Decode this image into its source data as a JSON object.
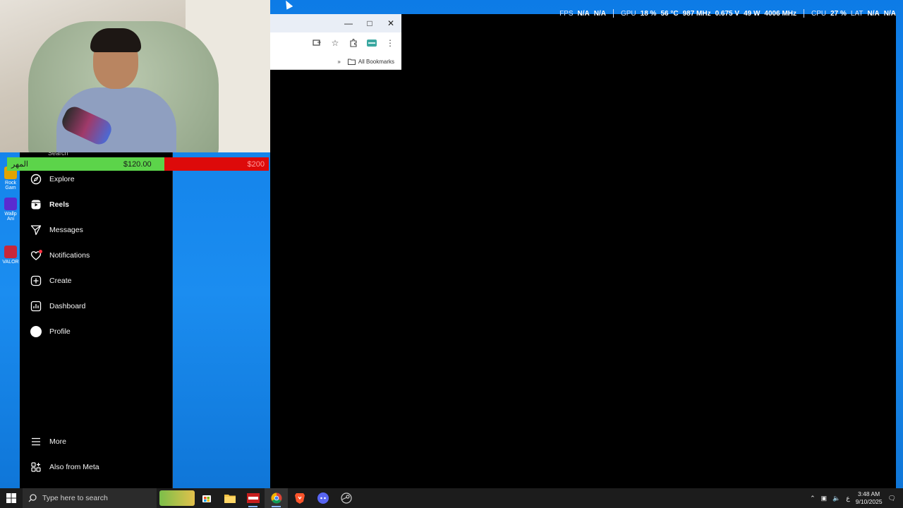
{
  "hud": {
    "fps_label": "FPS",
    "fps_value": "N/A",
    "fps_value2": "N/A",
    "gpu_label": "GPU",
    "gpu_util": "18 %",
    "gpu_temp": "56 °C",
    "gpu_clock": "987 MHz",
    "gpu_volt": "0.675 V",
    "gpu_power": "49 W",
    "gpu_mem_clock": "4006 MHz",
    "cpu_label": "CPU",
    "cpu_util": "27 %",
    "lat_label": "LAT",
    "lat_value": "N/A",
    "lat_value2": "N/A"
  },
  "chrome": {
    "minimize_icon": "minimize-icon",
    "maximize_icon": "maximize-icon",
    "close_icon": "close-icon",
    "bookmarks_overflow": "»",
    "all_bookmarks_label": "All Bookmarks"
  },
  "progress": {
    "left_label": "المهر",
    "current_amount": "$120.00",
    "goal_amount": "$200",
    "fraction": 0.6,
    "colors": {
      "filled": "#5cd44a",
      "remaining": "#dd0a0a"
    }
  },
  "sidebar": {
    "search_peek": "Search",
    "items": [
      {
        "label": "Explore",
        "icon": "compass-icon"
      },
      {
        "label": "Reels",
        "icon": "reels-icon"
      },
      {
        "label": "Messages",
        "icon": "send-icon"
      },
      {
        "label": "Notifications",
        "icon": "heart-icon"
      },
      {
        "label": "Create",
        "icon": "plus-square-icon"
      },
      {
        "label": "Dashboard",
        "icon": "chart-icon"
      },
      {
        "label": "Profile",
        "icon": "avatar-icon"
      }
    ],
    "more_label": "More",
    "meta_label": "Also from Meta"
  },
  "desktop_icons": [
    {
      "label": "Rock Gam"
    },
    {
      "label": "Wallp Ani"
    },
    {
      "label": "VALOR"
    }
  ],
  "taskbar": {
    "search_placeholder": "Type here to search",
    "tray_lang": "ع",
    "time": "3:48 AM",
    "date": "9/10/2025"
  }
}
